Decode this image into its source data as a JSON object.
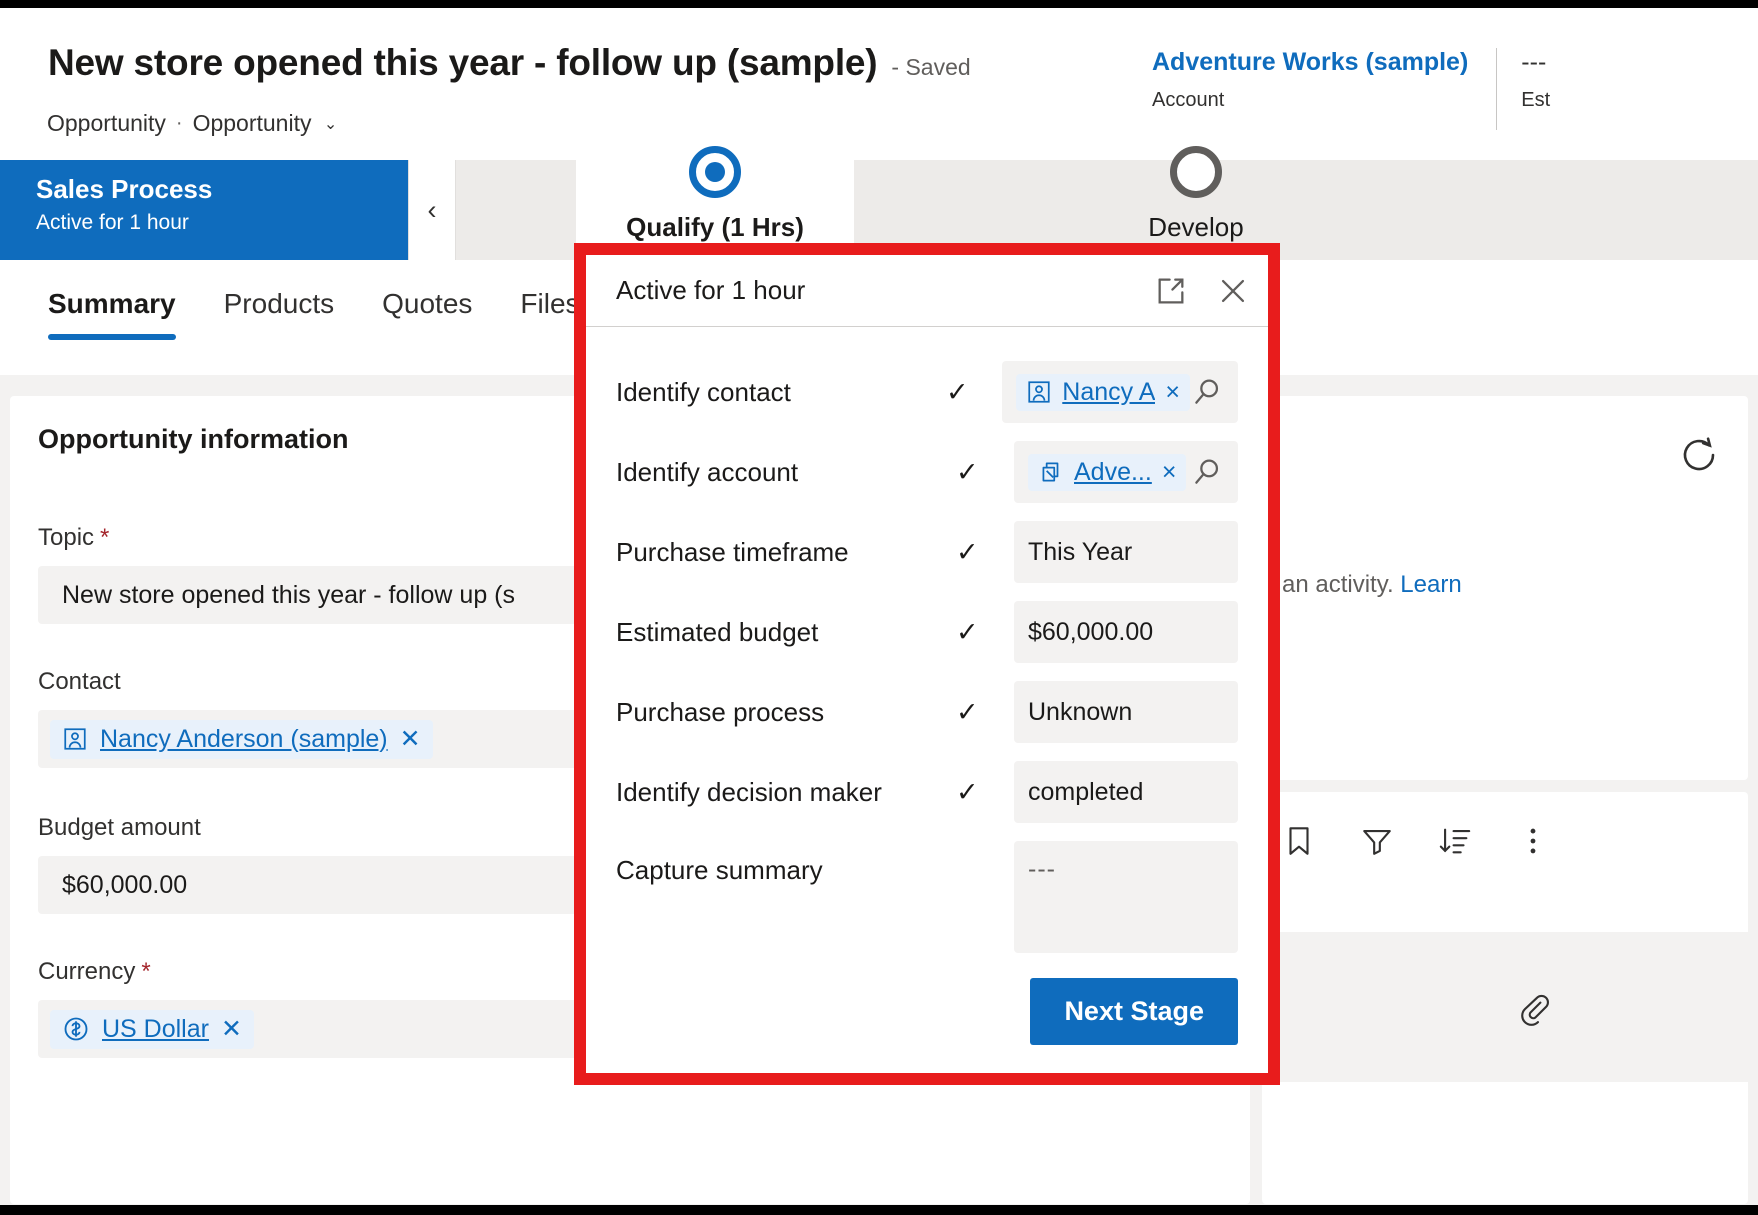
{
  "header": {
    "record_title": "New store opened this year - follow up (sample)",
    "save_state": "- Saved",
    "breadcrumb_entity": "Opportunity",
    "breadcrumb_form": "Opportunity",
    "account_value": "Adventure Works (sample)",
    "account_label": "Account",
    "est_value": "---",
    "est_label": "Est"
  },
  "process": {
    "name": "Sales Process",
    "active_for": "Active for 1 hour",
    "collapse_icon": "chevron-left-icon",
    "stages": [
      {
        "label": "Qualify  (1 Hrs)",
        "state": "active"
      },
      {
        "label": "Develop",
        "state": "inactive"
      }
    ]
  },
  "tabs": [
    {
      "label": "Summary",
      "active": true
    },
    {
      "label": "Products",
      "active": false
    },
    {
      "label": "Quotes",
      "active": false
    },
    {
      "label": "Files",
      "active": false
    }
  ],
  "form": {
    "section_title": "Opportunity information",
    "fields": [
      {
        "label": "Topic",
        "required": true,
        "value": "New store opened this year - follow up (s",
        "type": "text"
      },
      {
        "label": "Contact",
        "required": false,
        "value": "Nancy Anderson (sample)",
        "type": "lookup",
        "icon": "contact-icon"
      },
      {
        "label": "Budget amount",
        "required": false,
        "value": "$60,000.00",
        "type": "text"
      },
      {
        "label": "Currency",
        "required": true,
        "value": "US Dollar",
        "type": "lookup",
        "icon": "currency-icon"
      }
    ]
  },
  "timeline": {
    "refresh_icon": "refresh-icon",
    "empty_text_fragment": "g an activity.",
    "learn_link": "Learn"
  },
  "notes_toolbar": {
    "icons": [
      "bookmark-icon",
      "filter-icon",
      "sort-icon",
      "more-vertical-icon"
    ],
    "attachment_icon": "attachment-icon"
  },
  "dialog": {
    "title": "Active for 1 hour",
    "expand_icon": "expand-popout-icon",
    "close_icon": "close-icon",
    "search_icon": "search-icon",
    "checkmark": "✓",
    "steps": [
      {
        "label": "Identify contact",
        "checked": true,
        "type": "lookup",
        "value": "Nancy A",
        "icon": "contact-icon",
        "clear": "×",
        "search": true
      },
      {
        "label": "Identify account",
        "checked": true,
        "type": "lookup",
        "value": "Adve...",
        "icon": "account-icon",
        "clear": "×",
        "search": true
      },
      {
        "label": "Purchase timeframe",
        "checked": true,
        "type": "text",
        "value": "This Year"
      },
      {
        "label": "Estimated budget",
        "checked": true,
        "type": "text",
        "value": "$60,000.00"
      },
      {
        "label": "Purchase process",
        "checked": true,
        "type": "text",
        "value": "Unknown"
      },
      {
        "label": "Identify decision maker",
        "checked": true,
        "type": "text",
        "value": "completed"
      },
      {
        "label": "Capture summary",
        "checked": false,
        "type": "textarea",
        "value": "---"
      }
    ],
    "next_stage_label": "Next Stage",
    "accent_color": "#0f6cbd",
    "highlight_color": "#e81c1c"
  }
}
